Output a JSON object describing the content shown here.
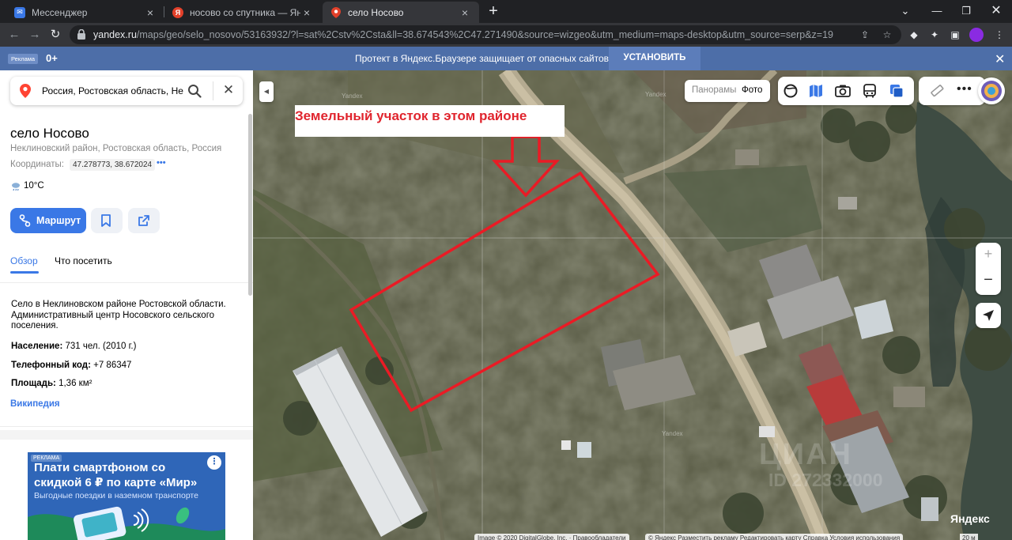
{
  "browser": {
    "tabs": [
      {
        "title": "Мессенджер",
        "favicon_color": "#3a78e6"
      },
      {
        "title": "носово со спутника — Яндекс: н",
        "favicon_color": "#e2402a"
      },
      {
        "title": "село Носово",
        "favicon_color": "#e2402a",
        "active": true
      }
    ],
    "url_host": "yandex.ru",
    "url_path": "/maps/geo/selo_nosovo/53163932/?l=sat%2Cstv%2Csta&ll=38.674543%2C47.271490&source=wizgeo&utm_medium=maps-desktop&utm_source=serp&z=19"
  },
  "adbar": {
    "label": "Реклама",
    "age": "0+",
    "message": "Протект в Яндекс.Браузере защищает от опасных сайтов",
    "install": "УСТАНОВИТЬ"
  },
  "sidebar": {
    "search_value": "Россия, Ростовская область, Не",
    "place_title": "село Носово",
    "place_subtitle": "Неклиновский район, Ростовская область, Россия",
    "coords_label": "Координаты:",
    "coords_value": "47.278773, 38.672024",
    "coords_more": "•••",
    "weather": "10°C",
    "route_label": "Маршрут",
    "tab_overview": "Обзор",
    "tab_visit": "Что посетить",
    "description": "Село в Неклиновском районе Ростовской области. Административный центр Носовского сельского поселения.",
    "population_label": "Население:",
    "population_value": "731 чел. (2010 г.)",
    "phone_label": "Телефонный код:",
    "phone_value": "+7 86347",
    "area_label": "Площадь:",
    "area_value": "1,36 км²",
    "wiki": "Википедия",
    "ad": {
      "label": "РЕКЛАМА",
      "headline": "Плати смартфоном со скидкой 6 ₽ по карте «Мир»",
      "sub": "Выгодные поездки в наземном транспорте"
    }
  },
  "map": {
    "annotation": "Земельный участок в этом районе",
    "panorama_label": "Панорамы",
    "photo_label": "Фото",
    "watermarks": [
      "Yandex",
      "Yandex",
      "Yandex"
    ],
    "copyright_left": "Image © 2020 DigitalGlobe, Inc. · Правообладатели",
    "copyright_right": "© Яндекс  Разместить рекламу  Редактировать карту  Справка  Условия использования",
    "logo": "Яндекс",
    "scale": "20 м",
    "overlay_watermark_1": "ЦИАН",
    "overlay_watermark_2": "ID 272332000",
    "zoom_in": "+",
    "zoom_out": "−"
  }
}
